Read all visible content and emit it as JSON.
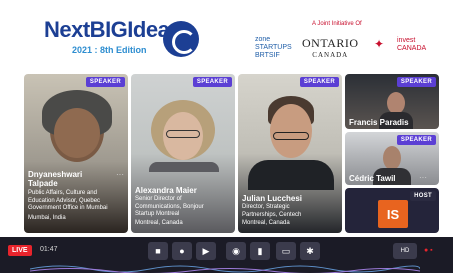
{
  "header": {
    "logo_title": "NextBIGIdea",
    "logo_subtitle": "2021 : 8th Edition",
    "joint_initiative": "A Joint Initiative Of",
    "partners": {
      "zone_line1": "zone",
      "zone_line2": "STARTUPS",
      "zone_line3": "BRTSIF",
      "ontario": "ONTARIO",
      "canada": "CANADA",
      "invest": "invest",
      "invest_canada": "CANADA"
    }
  },
  "tiles": [
    {
      "role": "SPEAKER",
      "name": "Dnyaneshwari Talpade",
      "title_lines": [
        "Public Affairs, Culture and",
        "Education Advisor, Quebec",
        "Government Office in Mumbai"
      ],
      "location": "Mumbai, India"
    },
    {
      "role": "SPEAKER",
      "name": "Alexandra Maier",
      "title_lines": [
        "Senior Director of",
        "Communications, Bonjour",
        "Startup Montreal"
      ],
      "location": "Montreal, Canada"
    },
    {
      "role": "SPEAKER",
      "name": "Julian Lucchesi",
      "title_lines": [
        "Director, Strategic",
        "Partnerships, Centech"
      ],
      "location": "Montreal, Canada"
    },
    {
      "role": "SPEAKER",
      "name": "Francis Paradis"
    },
    {
      "role": "SPEAKER",
      "name": "Cédric Tawil"
    },
    {
      "role": "HOST",
      "initials": "IS"
    }
  ],
  "controls": {
    "live_label": "LIVE",
    "elapsed": "01:47",
    "quality_label": "HD",
    "buttons": [
      "camera-icon",
      "mic-icon",
      "screen-share-icon",
      "record-icon",
      "stats-icon",
      "captions-icon",
      "settings-icon"
    ]
  },
  "colors": {
    "brand_blue": "#1c3f94",
    "accent_purple": "#5b3fd4",
    "live_red": "#e8242c",
    "host_orange": "#e8641f"
  }
}
